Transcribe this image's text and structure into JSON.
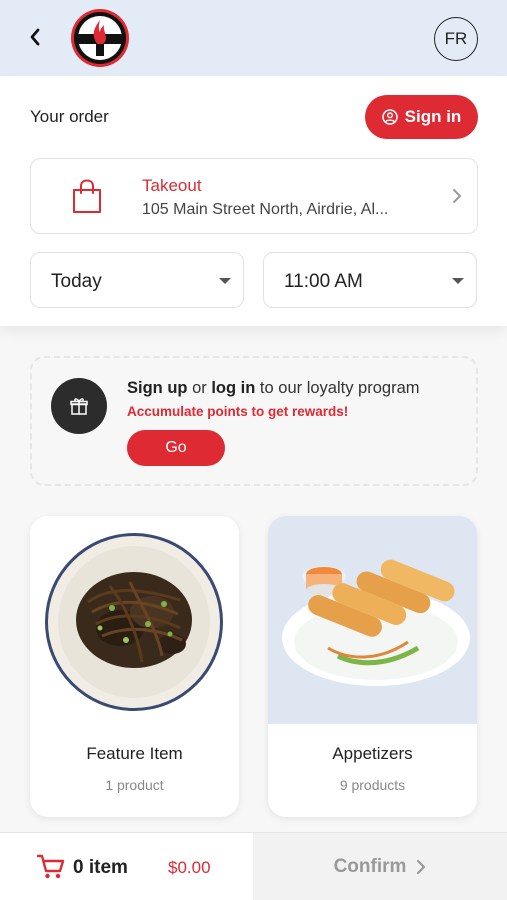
{
  "header": {
    "language_label": "FR"
  },
  "order": {
    "title": "Your order",
    "sign_in_label": "Sign in",
    "mode_label": "Takeout",
    "address": "105 Main Street North, Airdrie, Al...",
    "day_value": "Today",
    "time_value": "11:00 AM"
  },
  "loyalty": {
    "sign_up": "Sign up",
    "or": " or ",
    "log_in": "log in",
    "rest": " to our loyalty program",
    "subtitle": "Accumulate points to get rewards!",
    "go_label": "Go"
  },
  "categories": [
    {
      "name": "Feature Item",
      "count": "1 product"
    },
    {
      "name": "Appetizers",
      "count": "9 products"
    }
  ],
  "cart": {
    "count_label": "0 item",
    "total": "$0.00",
    "confirm_label": "Confirm"
  },
  "colors": {
    "accent": "#dd2a33",
    "header_bg": "#e3ebf6"
  }
}
